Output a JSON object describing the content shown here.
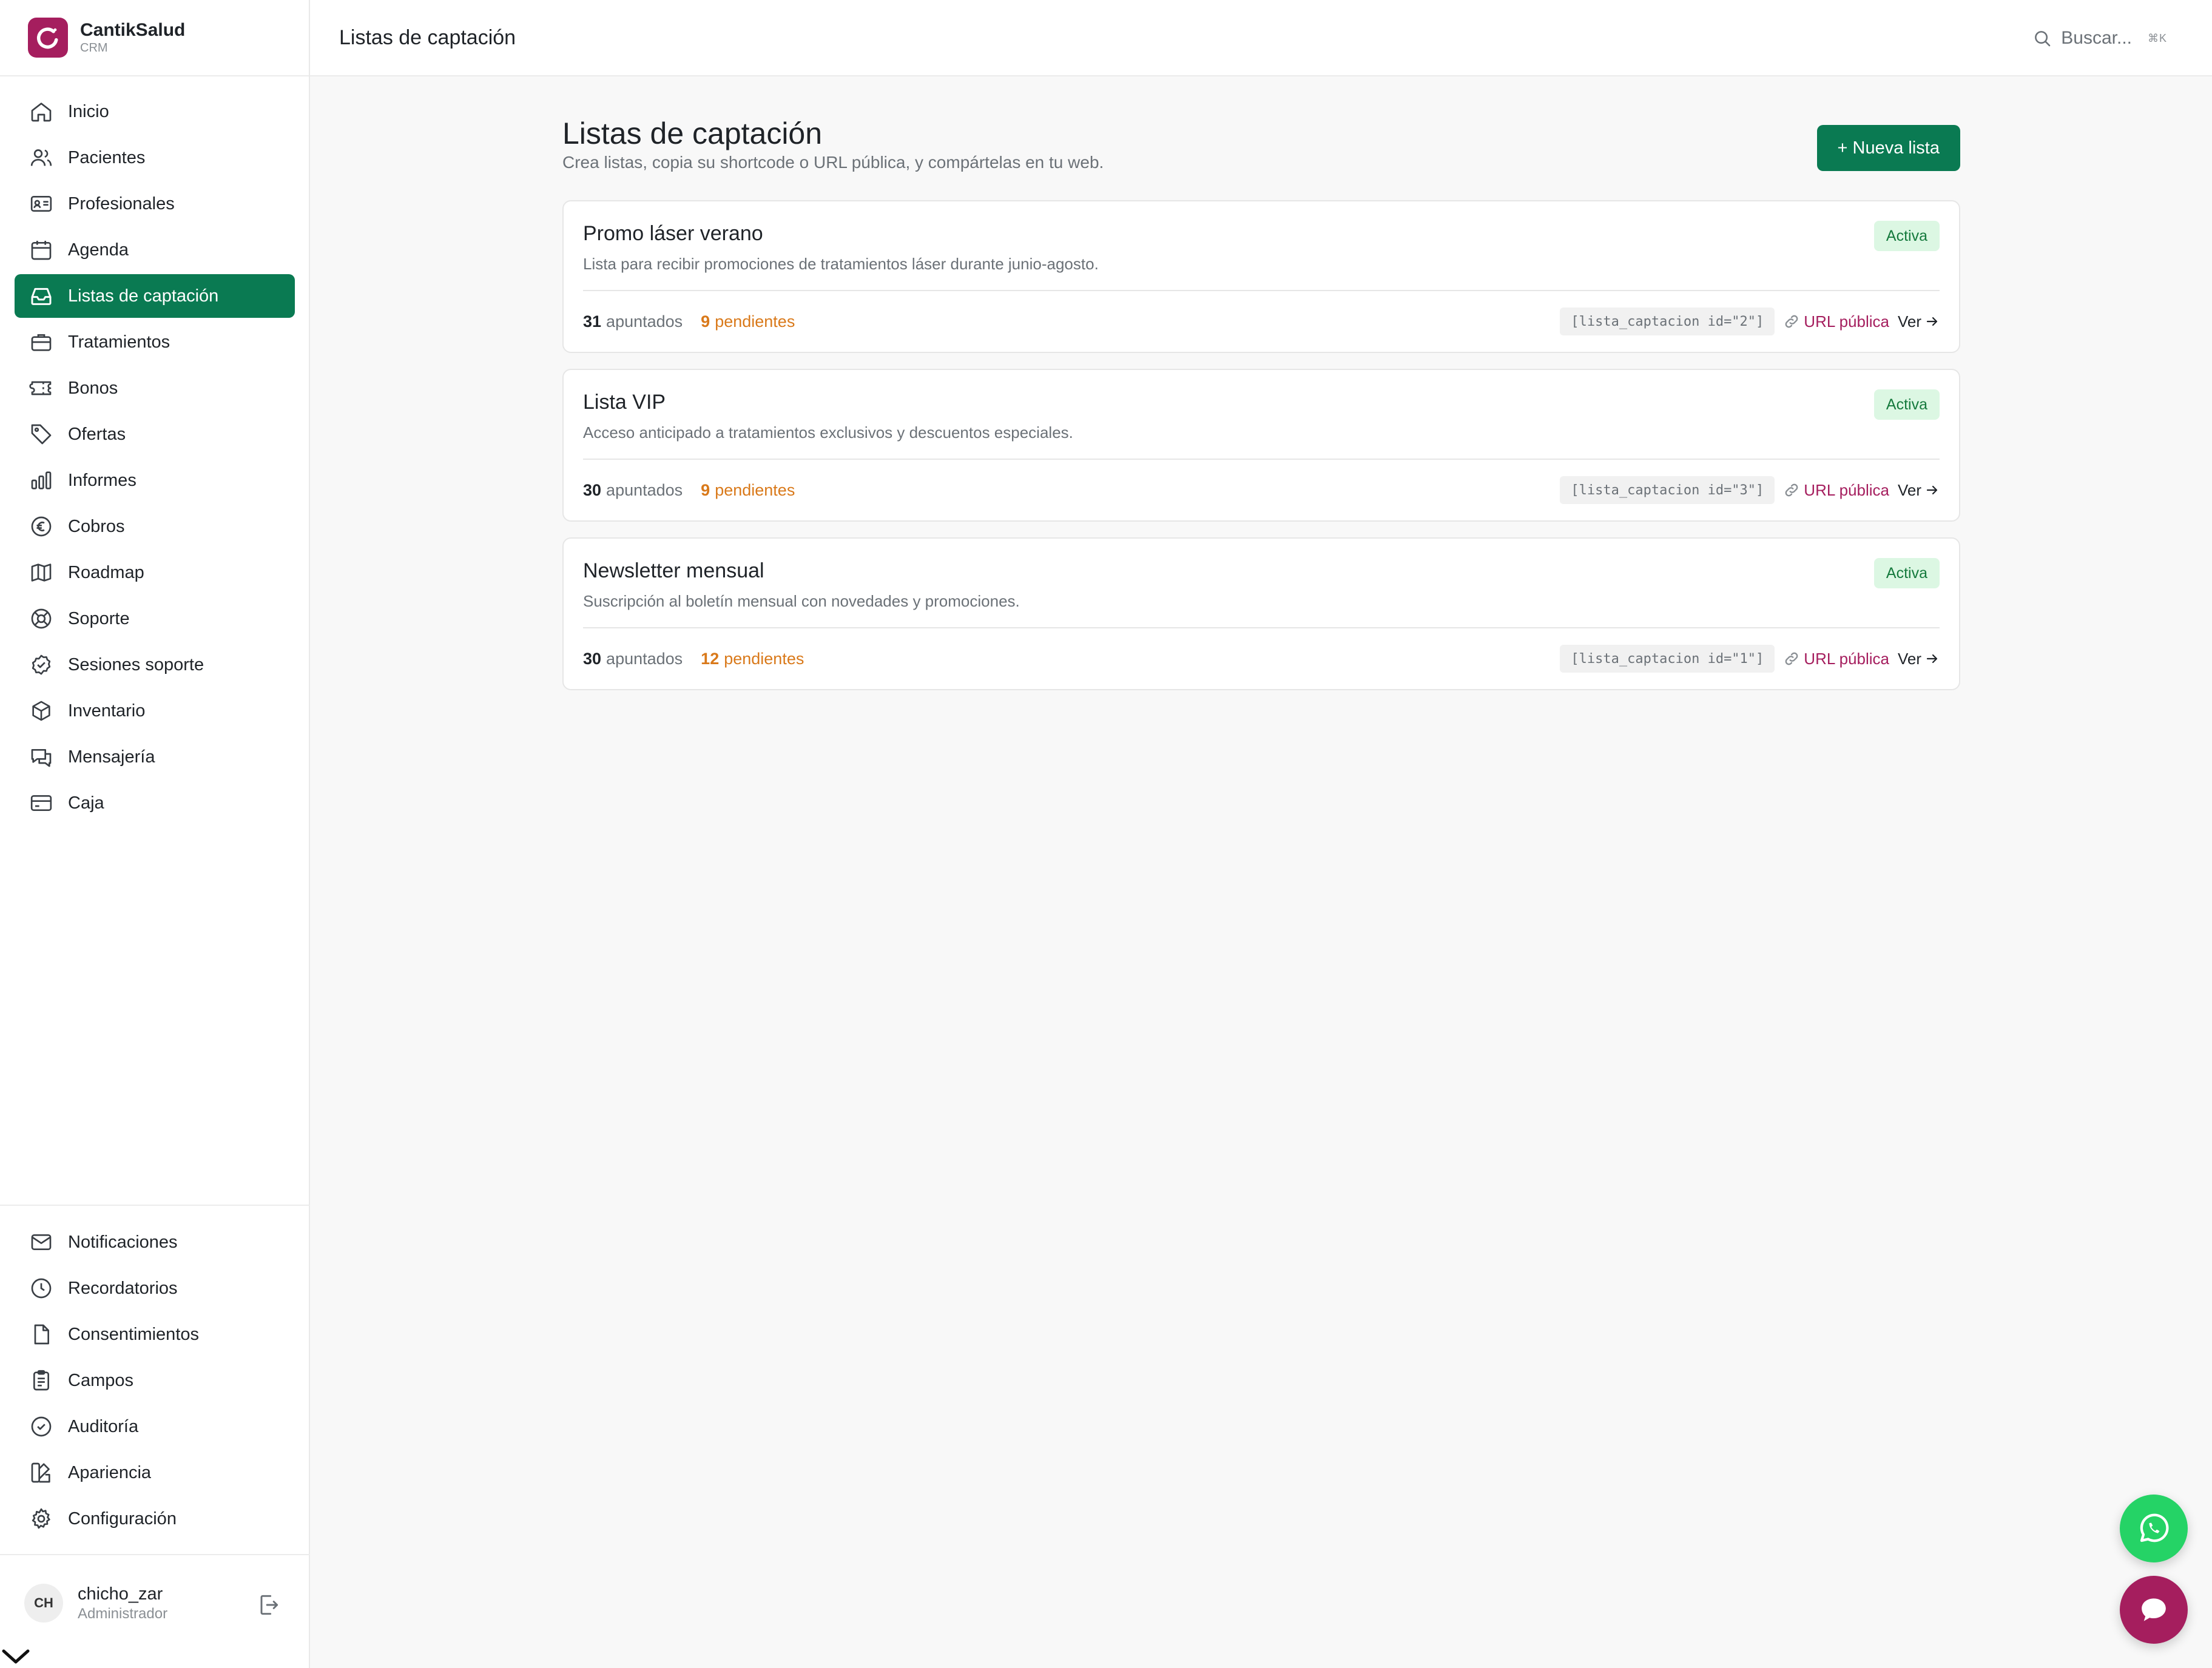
{
  "brand": {
    "name": "CantikSalud",
    "sub": "CRM"
  },
  "header": {
    "title": "Listas de captación",
    "search_placeholder": "Buscar...",
    "search_shortcut": "⌘K"
  },
  "sidebar": {
    "items": [
      {
        "label": "Inicio",
        "icon": "home-icon"
      },
      {
        "label": "Pacientes",
        "icon": "users-icon"
      },
      {
        "label": "Profesionales",
        "icon": "id-card-icon"
      },
      {
        "label": "Agenda",
        "icon": "calendar-icon"
      },
      {
        "label": "Listas de captación",
        "icon": "inbox-icon",
        "active": true
      },
      {
        "label": "Tratamientos",
        "icon": "briefcase-icon"
      },
      {
        "label": "Bonos",
        "icon": "ticket-icon"
      },
      {
        "label": "Ofertas",
        "icon": "tag-icon"
      },
      {
        "label": "Informes",
        "icon": "bar-chart-icon"
      },
      {
        "label": "Cobros",
        "icon": "euro-icon"
      },
      {
        "label": "Roadmap",
        "icon": "map-icon"
      },
      {
        "label": "Soporte",
        "icon": "lifebuoy-icon"
      },
      {
        "label": "Sesiones soporte",
        "icon": "check-badge-icon"
      },
      {
        "label": "Inventario",
        "icon": "box-icon"
      },
      {
        "label": "Mensajería",
        "icon": "messages-icon"
      },
      {
        "label": "Caja",
        "icon": "credit-card-icon"
      }
    ],
    "bottom_items": [
      {
        "label": "Notificaciones",
        "icon": "mail-icon"
      },
      {
        "label": "Recordatorios",
        "icon": "clock-icon"
      },
      {
        "label": "Consentimientos",
        "icon": "file-icon"
      },
      {
        "label": "Campos",
        "icon": "clipboard-icon"
      },
      {
        "label": "Auditoría",
        "icon": "shield-check-icon"
      },
      {
        "label": "Apariencia",
        "icon": "palette-icon"
      },
      {
        "label": "Configuración",
        "icon": "gear-icon"
      }
    ]
  },
  "user": {
    "initials": "CH",
    "name": "chicho_zar",
    "role": "Administrador"
  },
  "main": {
    "title": "Listas de captación",
    "subtitle": "Crea listas, copia su shortcode o URL pública, y compártelas en tu web.",
    "new_button": "+ Nueva lista",
    "stat_label": "apuntados",
    "pending_label": "pendientes",
    "url_label": "URL pública",
    "view_label": "Ver",
    "lists": [
      {
        "title": "Promo láser verano",
        "description": "Lista para recibir promociones de tratamientos láser durante junio-agosto.",
        "status": "Activa",
        "signups": "31",
        "pending": "9",
        "shortcode": "[lista_captacion id=\"2\"]"
      },
      {
        "title": "Lista VIP",
        "description": "Acceso anticipado a tratamientos exclusivos y descuentos especiales.",
        "status": "Activa",
        "signups": "30",
        "pending": "9",
        "shortcode": "[lista_captacion id=\"3\"]"
      },
      {
        "title": "Newsletter mensual",
        "description": "Suscripción al boletín mensual con novedades y promociones.",
        "status": "Activa",
        "signups": "30",
        "pending": "12",
        "shortcode": "[lista_captacion id=\"1\"]"
      }
    ]
  },
  "colors": {
    "accent": "#0a7a52",
    "brand": "#a51e5e",
    "pending": "#d9791a",
    "status_bg": "#dcf7e3",
    "status_text": "#157a3d",
    "whatsapp": "#25d366"
  },
  "floating": {
    "whatsapp_icon": "whatsapp-icon",
    "chat_icon": "chat-bubble-icon"
  }
}
